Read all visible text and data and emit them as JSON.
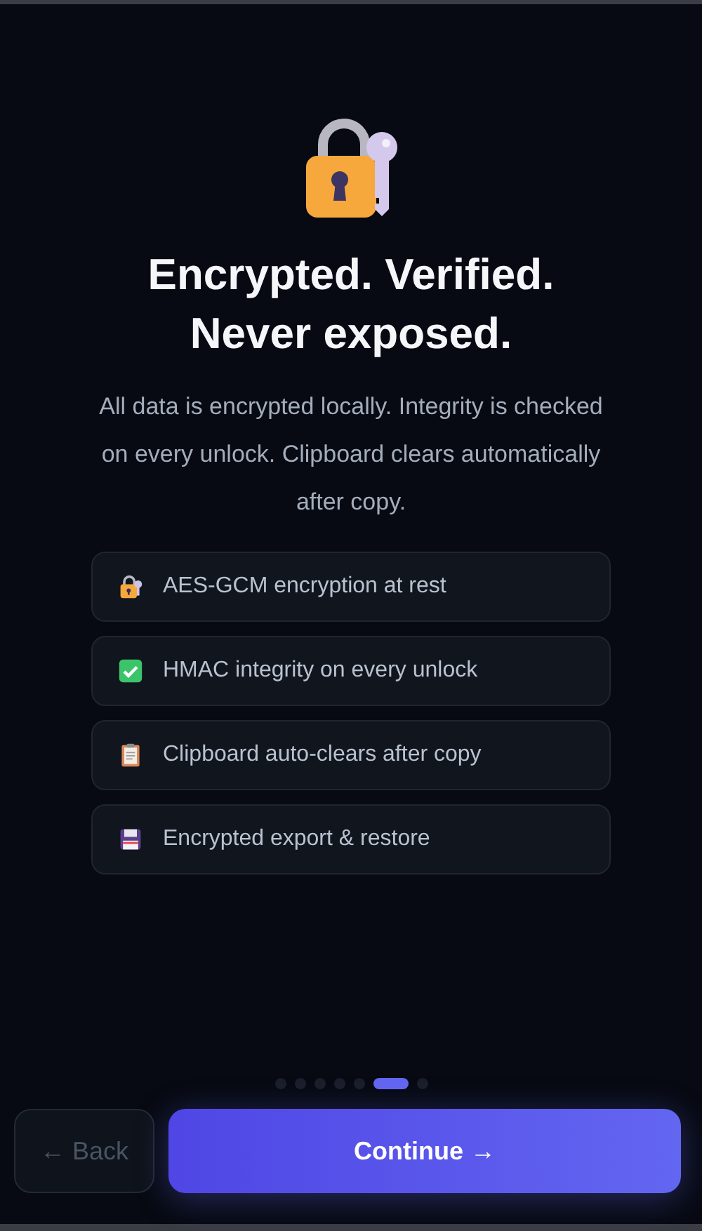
{
  "hero": {
    "title_lines": [
      "Encrypted. Verified.",
      "Never exposed."
    ],
    "description": "All data is encrypted locally. Integrity is checked on every unlock. Clipboard clears automatically after copy."
  },
  "features": [
    {
      "kind": "lock",
      "label": "AES-GCM encryption at rest"
    },
    {
      "kind": "check",
      "label": "HMAC integrity on every unlock"
    },
    {
      "kind": "clipboard",
      "label": "Clipboard auto-clears after copy"
    },
    {
      "kind": "disk",
      "label": "Encrypted export & restore"
    }
  ],
  "pager": [
    {
      "selected": false
    },
    {
      "selected": false
    },
    {
      "selected": false
    },
    {
      "selected": false
    },
    {
      "selected": false
    },
    {
      "selected": true
    },
    {
      "selected": false
    }
  ],
  "buttons": {
    "back": {
      "label": "← Back",
      "disabled": true
    },
    "continue": {
      "label": "Continue →"
    }
  }
}
